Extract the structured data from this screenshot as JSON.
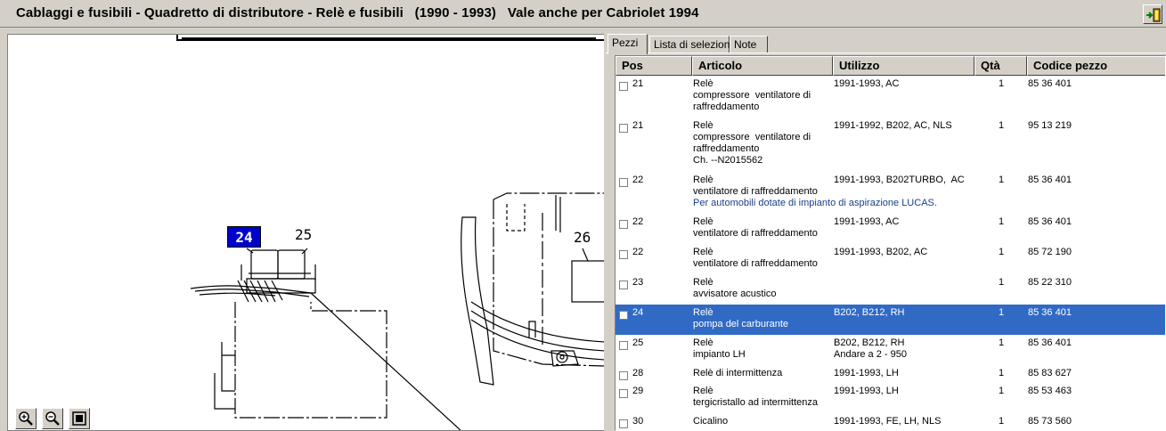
{
  "window": {
    "title": "Cablaggi e fusibili - Quadretto di distributore - Relè e fusibili   (1990 - 1993)   Vale anche per Cabriolet 1994",
    "exit_icon": "exit-door-icon"
  },
  "diagram": {
    "callouts": {
      "c24": "24",
      "c25": "25",
      "c26": "26"
    },
    "zoom_in_icon": "zoom-in-icon",
    "zoom_out_icon": "zoom-out-icon",
    "fit_icon": "fit-to-window-icon"
  },
  "tabs": [
    {
      "label": "Pezzi",
      "active": true
    },
    {
      "label": "Lista di selezione",
      "active": false
    },
    {
      "label": "Note",
      "active": false
    }
  ],
  "table": {
    "headers": {
      "pos": "Pos",
      "articolo": "Articolo",
      "utilizzo": "Utilizzo",
      "qta": "Qtà",
      "codice": "Codice pezzo"
    },
    "rows": [
      {
        "pos": "21",
        "articolo": [
          "Relè",
          "compressore  ventilatore di",
          "raffreddamento"
        ],
        "utilizzo": [
          "1991-1993, AC"
        ],
        "qta": "1",
        "codice": "85 36 401",
        "note": ""
      },
      {
        "pos": "21",
        "articolo": [
          "Relè",
          "compressore  ventilatore di",
          "raffreddamento",
          "Ch. --N2015562"
        ],
        "utilizzo": [
          "1991-1992, B202, AC, NLS"
        ],
        "qta": "1",
        "codice": "95 13 219",
        "note": ""
      },
      {
        "pos": "22",
        "articolo": [
          "Relè",
          "ventilatore di raffreddamento"
        ],
        "utilizzo": [
          "1991-1993, B202TURBO,  AC"
        ],
        "qta": "1",
        "codice": "85 36 401",
        "note": "Per automobili dotate di impianto di aspirazione LUCAS."
      },
      {
        "pos": "22",
        "articolo": [
          "Relè",
          "ventilatore di raffreddamento"
        ],
        "utilizzo": [
          "1991-1993, AC"
        ],
        "qta": "1",
        "codice": "85 36 401",
        "note": ""
      },
      {
        "pos": "22",
        "articolo": [
          "Relè",
          "ventilatore di raffreddamento"
        ],
        "utilizzo": [
          "1991-1993, B202, AC"
        ],
        "qta": "1",
        "codice": "85 72 190",
        "note": ""
      },
      {
        "pos": "23",
        "articolo": [
          "Relè",
          "avvisatore acustico"
        ],
        "utilizzo": [
          ""
        ],
        "qta": "1",
        "codice": "85 22 310",
        "note": ""
      },
      {
        "pos": "24",
        "articolo": [
          "Relè",
          "pompa del carburante"
        ],
        "utilizzo": [
          "B202, B212, RH"
        ],
        "qta": "1",
        "codice": "85 36 401",
        "note": "",
        "selected": true
      },
      {
        "pos": "25",
        "articolo": [
          "Relè",
          "impianto LH"
        ],
        "utilizzo": [
          "B202, B212, RH",
          "Andare a 2 - 950"
        ],
        "qta": "1",
        "codice": "85 36 401",
        "note": ""
      },
      {
        "pos": "28",
        "articolo": [
          "Relè di intermittenza"
        ],
        "utilizzo": [
          "1991-1993, LH"
        ],
        "qta": "1",
        "codice": "85 83 627",
        "note": ""
      },
      {
        "pos": "29",
        "articolo": [
          "Relè",
          "tergicristallo ad intermittenza"
        ],
        "utilizzo": [
          "1991-1993, LH"
        ],
        "qta": "1",
        "codice": "85 53 463",
        "note": ""
      },
      {
        "pos": "30",
        "articolo": [
          "Cicalino"
        ],
        "utilizzo": [
          "1991-1993, FE, LH, NLS"
        ],
        "qta": "1",
        "codice": "85 73 560",
        "note": ""
      }
    ]
  },
  "colors": {
    "selected_row": "#316ac5",
    "callout_highlight": "#0000cc",
    "note_text": "#1a3e8c"
  }
}
